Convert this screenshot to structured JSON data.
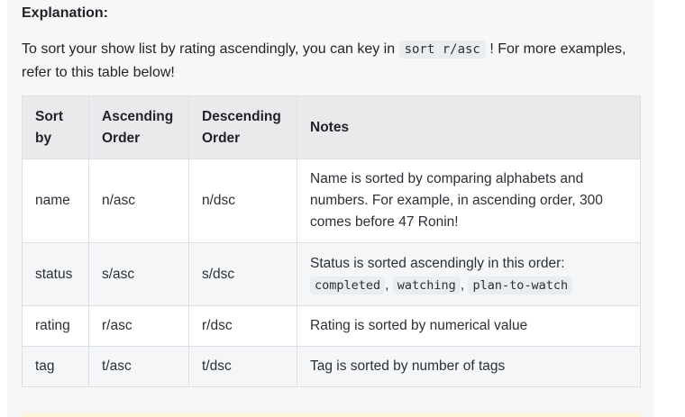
{
  "explanation": {
    "heading": "Explanation:",
    "intro_before": "To sort your show list by rating ascendingly, you can key in",
    "intro_code": "sort r/asc",
    "intro_after": "! For more examples, refer to this table below!"
  },
  "table": {
    "headers": [
      "Sort by",
      "Ascending Order",
      "Descending Order",
      "Notes"
    ],
    "rows": [
      {
        "sort_by": "name",
        "asc": "n/asc",
        "dsc": "n/dsc",
        "note": "Name is sorted by comparing alphabets and numbers. For example, in ascending order, 300 comes before 47 Ronin!"
      },
      {
        "sort_by": "status",
        "asc": "s/asc",
        "dsc": "s/dsc",
        "note": "Status is sorted ascendingly in this order:",
        "note_codes": [
          "completed",
          "watching",
          "plan-to-watch"
        ],
        "note_sep": ","
      },
      {
        "sort_by": "rating",
        "asc": "r/asc",
        "dsc": "r/dsc",
        "note": "Rating is sorted by numerical value"
      },
      {
        "sort_by": "tag",
        "asc": "t/asc",
        "dsc": "t/dsc",
        "note": "Tag is sorted by number of tags"
      }
    ]
  }
}
